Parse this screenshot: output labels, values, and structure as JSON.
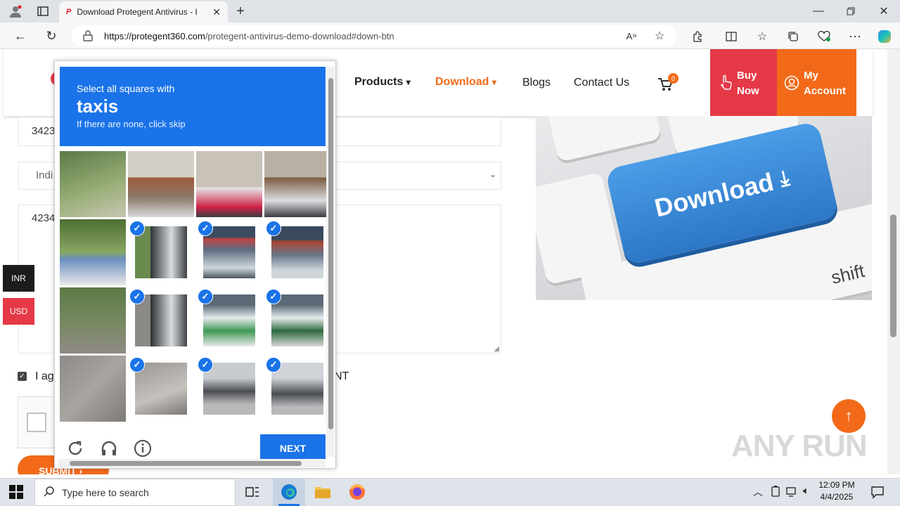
{
  "browser": {
    "tab_title": "Download Protegent Antivirus - I",
    "tab_favicon": "P",
    "url_domain": "https://protegent360.com",
    "url_path": "/protegent-antivirus-demo-download#down-btn",
    "new_tab": "+"
  },
  "site": {
    "nav": {
      "products": "Products",
      "download": "Download",
      "blogs": "Blogs",
      "contact": "Contact Us",
      "cart_count": "0"
    },
    "buy_now": [
      "Buy",
      "Now"
    ],
    "my_account": [
      "My",
      "Account"
    ],
    "form": {
      "field1_value": "3423",
      "select_value": "Indi",
      "textarea_value": "4234",
      "agree_text": "I ag",
      "agree_tail": "NT",
      "submit": "SUBMIT"
    },
    "download_key_text": "Download",
    "currency": [
      "INR",
      "USD"
    ],
    "colors": {
      "orange": "#f26a19",
      "red": "#e53947",
      "blue": "#1a73e8"
    }
  },
  "captcha": {
    "instruction": "Select all squares with",
    "target": "taxis",
    "hint": "If there are none, click skip",
    "next_label": "NEXT",
    "tiles": [
      {
        "selected": false
      },
      {
        "selected": false
      },
      {
        "selected": false
      },
      {
        "selected": false
      },
      {
        "selected": false
      },
      {
        "selected": true
      },
      {
        "selected": true
      },
      {
        "selected": true
      },
      {
        "selected": false
      },
      {
        "selected": true
      },
      {
        "selected": true
      },
      {
        "selected": true
      },
      {
        "selected": false
      },
      {
        "selected": true
      },
      {
        "selected": true
      },
      {
        "selected": true
      }
    ]
  },
  "taskbar": {
    "search_placeholder": "Type here to search",
    "time": "12:09 PM",
    "date": "4/4/2025"
  },
  "watermark": "ANY RUN"
}
